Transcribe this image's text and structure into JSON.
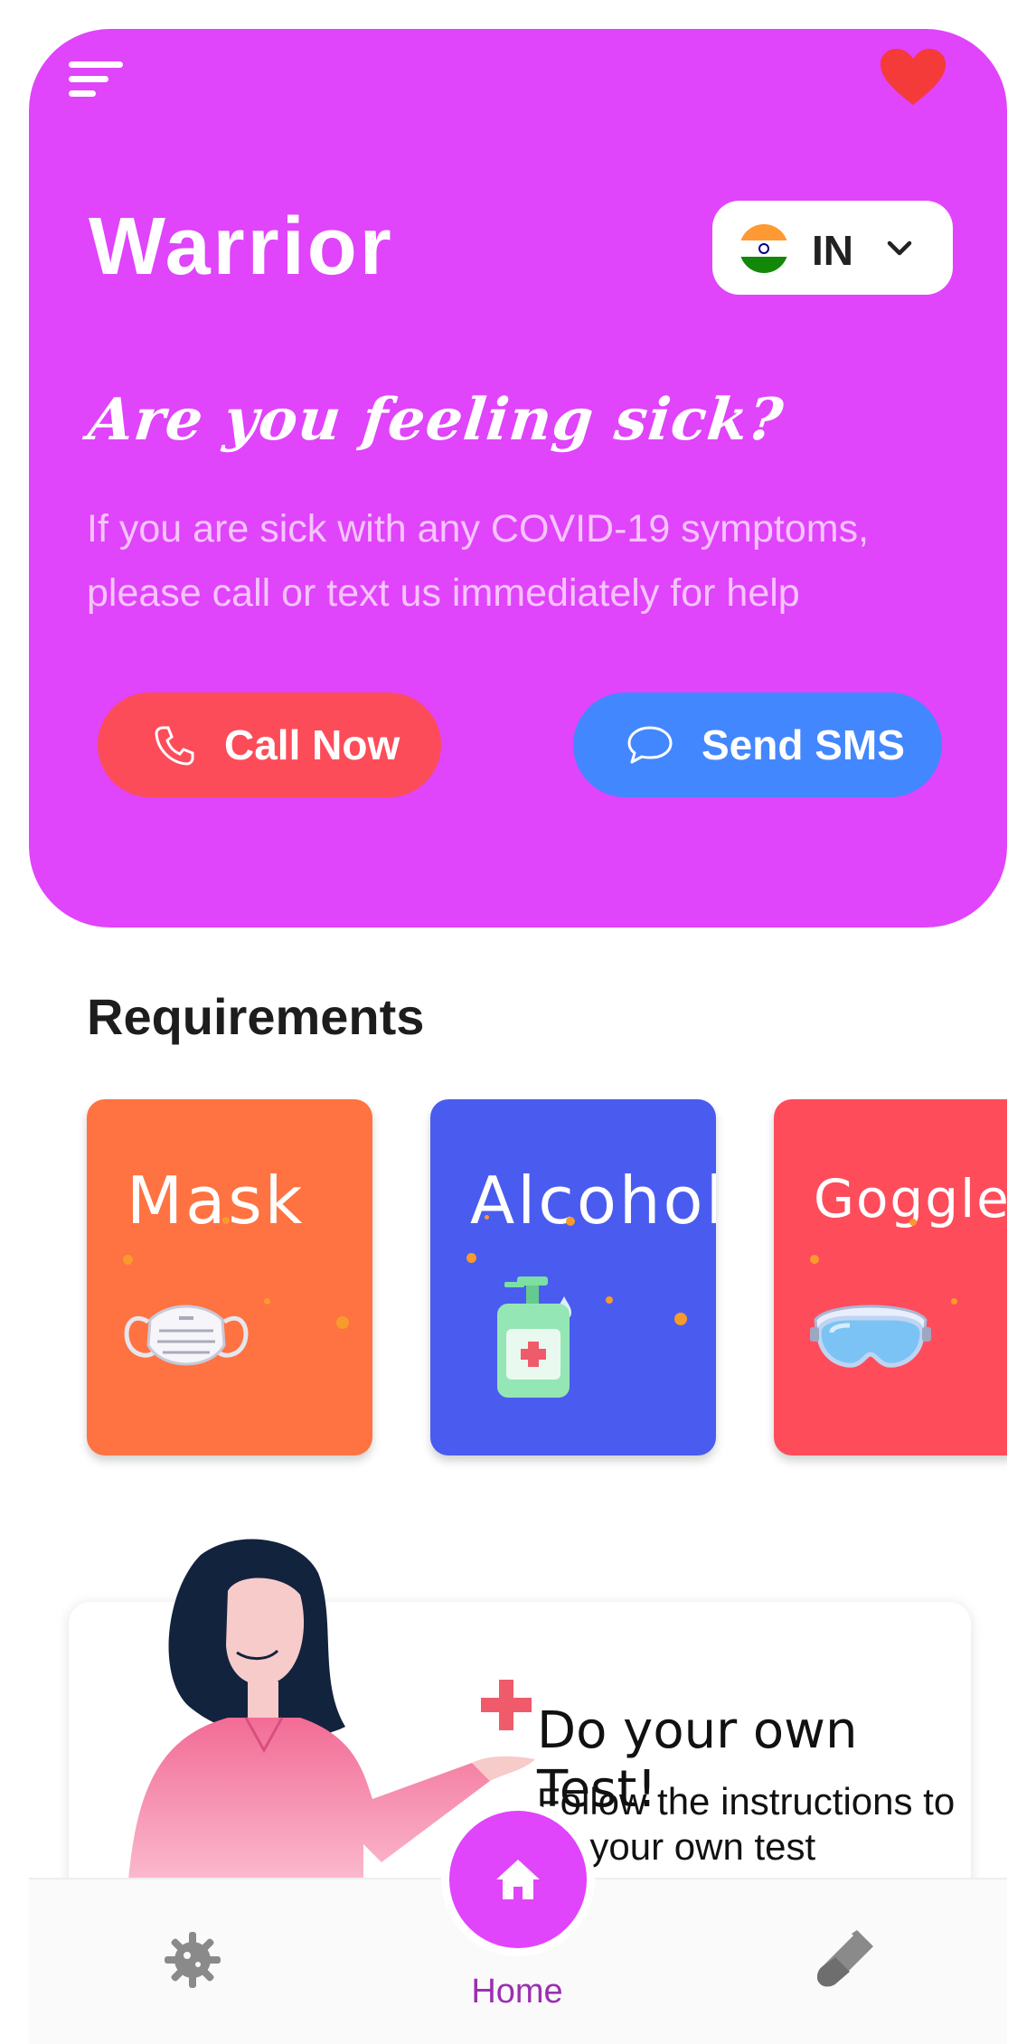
{
  "header": {
    "brand": "Warrior",
    "country_code": "IN",
    "tagline": "Are you feeling sick?",
    "description": "If you are sick with any COVID-19 symptoms, please call or text us immediately for help",
    "call_label": "Call Now",
    "sms_label": "Send SMS"
  },
  "requirements": {
    "title": "Requirements",
    "items": [
      {
        "label": "Mask",
        "icon": "face-mask-icon"
      },
      {
        "label": "Alcohol",
        "icon": "sanitizer-icon"
      },
      {
        "label": "Goggles",
        "icon": "goggles-icon"
      }
    ]
  },
  "test_card": {
    "title": "Do your own Test!",
    "subtitle": "Follow the instructions to do your own test"
  },
  "nav": {
    "items": [
      {
        "icon": "virus-icon"
      },
      {
        "icon": "home-icon",
        "label": "Home"
      },
      {
        "icon": "test-tube-icon"
      }
    ],
    "active": "Home"
  },
  "colors": {
    "hero": "#e044fb",
    "call": "#fd4c59",
    "sms": "#4387fe",
    "mask_card": "#fe7341",
    "alcohol_card": "#4a5cef",
    "goggles_card": "#fe4c5b",
    "nav_active": "#9b2fb1"
  }
}
